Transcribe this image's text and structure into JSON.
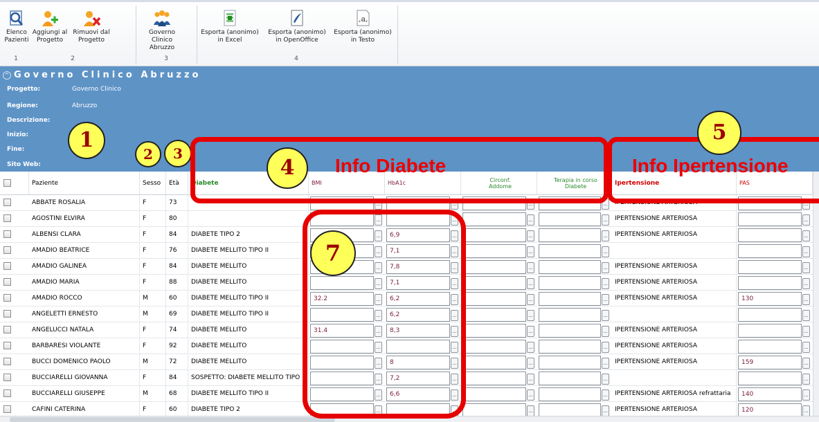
{
  "ribbon": {
    "buttons": [
      {
        "label": "Elenco\nPazienti",
        "icon": "patient-list-icon"
      },
      {
        "label": "Aggiungi al\nProgetto",
        "icon": "add-to-project-icon"
      },
      {
        "label": "Rimuovi dal\nProgetto",
        "icon": "remove-from-project-icon"
      },
      {
        "label": "Governo Clinico\nAbruzzo",
        "icon": "group-icon"
      },
      {
        "label": "Esporta (anonimo)\nin Excel",
        "icon": "excel-icon"
      },
      {
        "label": "Esporta (anonimo)\nin OpenOffice",
        "icon": "openoffice-icon"
      },
      {
        "label": "Esporta (anonimo)\nin Testo",
        "icon": "text-file-icon"
      }
    ],
    "groups": [
      "1",
      "2",
      "3",
      "4"
    ]
  },
  "panel": {
    "title": "Governo Clinico Abruzzo",
    "fields": [
      {
        "label": "Progetto:",
        "value": "Governo Clinico"
      },
      {
        "label": "Regione:",
        "value": "Abruzzo"
      },
      {
        "label": "Descrizione:",
        "value": ""
      },
      {
        "label": "Inizio:",
        "value": ""
      },
      {
        "label": "Fine:",
        "value": ""
      },
      {
        "label": "Sito Web:",
        "value": ""
      }
    ]
  },
  "annotations": {
    "c1": "1",
    "c2": "2",
    "c3": "3",
    "c4": "4",
    "c5": "5",
    "c7": "7",
    "info_diabete": "Info Diabete",
    "info_ipertensione": "Info Ipertensione"
  },
  "colors": {
    "accent_red": "#e60000",
    "panel_blue": "#5e93c6",
    "circle_yellow": "#ffff5a"
  },
  "grid": {
    "headers": {
      "paziente": "Paziente",
      "sesso": "Sesso",
      "eta": "Età",
      "diabete": "Diabete",
      "bmi": "BMI",
      "hba1c": "HbA1c",
      "circonf": "Circonf.\nAddome",
      "terapia": "Terapia in corso\nDiabete",
      "ipertensione": "Ipertensione",
      "pas": "PAS"
    },
    "rows": [
      {
        "paziente": "ABBATE ROSALIA",
        "sesso": "F",
        "eta": "73",
        "diabete": "",
        "bmi": "",
        "hba1c": "",
        "ipertensione": "IPERTENSIONE ARTERIOSA",
        "pas": ""
      },
      {
        "paziente": "AGOSTINI ELVIRA",
        "sesso": "F",
        "eta": "80",
        "diabete": "",
        "bmi": "",
        "hba1c": "",
        "ipertensione": "IPERTENSIONE ARTERIOSA",
        "pas": ""
      },
      {
        "paziente": "ALBENSI CLARA",
        "sesso": "F",
        "eta": "84",
        "diabete": "DIABETE TIPO 2",
        "bmi": "",
        "hba1c": "6,9",
        "ipertensione": "IPERTENSIONE ARTERIOSA",
        "pas": ""
      },
      {
        "paziente": "AMADIO BEATRICE",
        "sesso": "F",
        "eta": "76",
        "diabete": "DIABETE MELLITO TIPO II",
        "bmi": "",
        "hba1c": "7,1",
        "ipertensione": "",
        "pas": ""
      },
      {
        "paziente": "AMADIO GALINEA",
        "sesso": "F",
        "eta": "84",
        "diabete": "DIABETE MELLITO",
        "bmi": "",
        "hba1c": "7,8",
        "ipertensione": "IPERTENSIONE ARTERIOSA",
        "pas": ""
      },
      {
        "paziente": "AMADIO MARIA",
        "sesso": "F",
        "eta": "88",
        "diabete": "DIABETE MELLITO",
        "bmi": "",
        "hba1c": "7,1",
        "ipertensione": "IPERTENSIONE ARTERIOSA",
        "pas": ""
      },
      {
        "paziente": "AMADIO ROCCO",
        "sesso": "M",
        "eta": "60",
        "diabete": "DIABETE MELLITO TIPO II",
        "bmi": "32.2",
        "hba1c": "6,2",
        "ipertensione": "IPERTENSIONE ARTERIOSA",
        "pas": "130"
      },
      {
        "paziente": "ANGELETTI ERNESTO",
        "sesso": "M",
        "eta": "69",
        "diabete": "DIABETE MELLITO TIPO II",
        "bmi": "",
        "hba1c": "6,2",
        "ipertensione": "",
        "pas": ""
      },
      {
        "paziente": "ANGELUCCI NATALA",
        "sesso": "F",
        "eta": "74",
        "diabete": "DIABETE MELLITO",
        "bmi": "31.4",
        "hba1c": "8,3",
        "ipertensione": "IPERTENSIONE ARTERIOSA",
        "pas": ""
      },
      {
        "paziente": "BARBARESI VIOLANTE",
        "sesso": "F",
        "eta": "92",
        "diabete": "DIABETE MELLITO",
        "bmi": "",
        "hba1c": "",
        "ipertensione": "IPERTENSIONE ARTERIOSA",
        "pas": ""
      },
      {
        "paziente": "BUCCI DOMENICO PAOLO",
        "sesso": "M",
        "eta": "72",
        "diabete": "DIABETE MELLITO",
        "bmi": "",
        "hba1c": "8",
        "ipertensione": "IPERTENSIONE ARTERIOSA",
        "pas": "159"
      },
      {
        "paziente": "BUCCIARELLI GIOVANNA",
        "sesso": "F",
        "eta": "84",
        "diabete": "SOSPETTO: DIABETE MELLITO TIPO",
        "bmi": "",
        "hba1c": "7,2",
        "ipertensione": "",
        "pas": ""
      },
      {
        "paziente": "BUCCIARELLI GIUSEPPE",
        "sesso": "M",
        "eta": "68",
        "diabete": "DIABETE MELLITO TIPO II",
        "bmi": "",
        "hba1c": "6,6",
        "ipertensione": "IPERTENSIONE ARTERIOSA refrattaria",
        "pas": "140"
      },
      {
        "paziente": "CAFINI CATERINA",
        "sesso": "F",
        "eta": "60",
        "diabete": "DIABETE TIPO 2",
        "bmi": "",
        "hba1c": "",
        "ipertensione": "IPERTENSIONE ARTERIOSA",
        "pas": "120"
      }
    ]
  }
}
